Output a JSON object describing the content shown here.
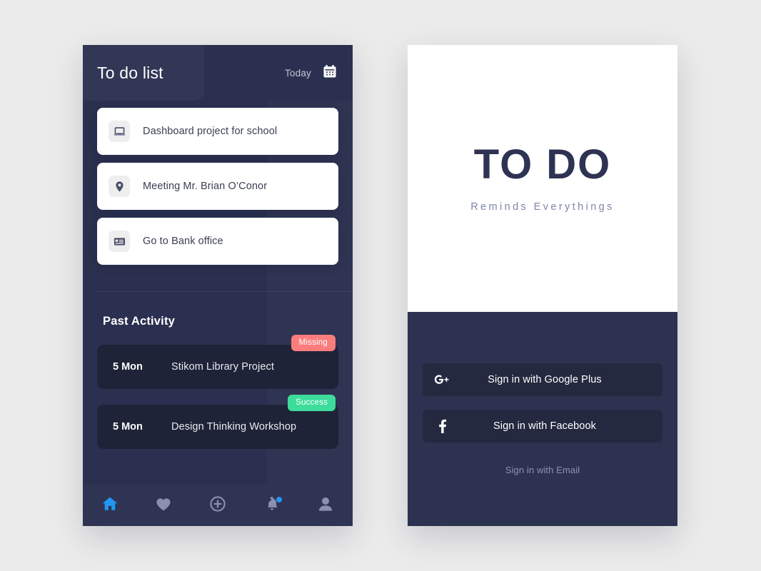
{
  "theme": {
    "page_bg": "#ebebeb",
    "panel_navy": "#2b3050",
    "splash_navy": "#2d3250",
    "card_dark": "#1e2337",
    "accent_blue": "#2196f3",
    "badge_missing": "#fa7d7d",
    "badge_success": "#3ddc9a"
  },
  "todo_app": {
    "header": {
      "title": "To do list",
      "today_label": "Today",
      "calendar_icon": "calendar-icon"
    },
    "tasks": [
      {
        "icon": "laptop-icon",
        "label": "Dashboard project for school"
      },
      {
        "icon": "location-pin-icon",
        "label": "Meeting Mr. Brian O’Conor"
      },
      {
        "icon": "bank-card-icon",
        "label": "Go to Bank office"
      }
    ],
    "past_activity": {
      "title": "Past Activity",
      "items": [
        {
          "date": "5 Mon",
          "name": "Stikom Library Project",
          "badge": "Missing",
          "badge_color": "#fa7d7d"
        },
        {
          "date": "5 Mon",
          "name": "Design Thinking Workshop",
          "badge": "Success",
          "badge_color": "#3ddc9a"
        }
      ]
    },
    "bottom_nav": [
      {
        "icon": "home-icon",
        "active": true,
        "dot": false
      },
      {
        "icon": "heart-icon",
        "active": false,
        "dot": false
      },
      {
        "icon": "plus-circle-icon",
        "active": false,
        "dot": false
      },
      {
        "icon": "bell-icon",
        "active": false,
        "dot": true
      },
      {
        "icon": "person-icon",
        "active": false,
        "dot": false
      }
    ]
  },
  "splash": {
    "brand_title": "TO DO",
    "tagline": "Reminds Everythings",
    "buttons": [
      {
        "icon": "google-plus-icon",
        "label": "Sign in with Google Plus"
      },
      {
        "icon": "facebook-icon",
        "label": "Sign in with Facebook"
      }
    ],
    "email_link": "Sign in with Email"
  }
}
